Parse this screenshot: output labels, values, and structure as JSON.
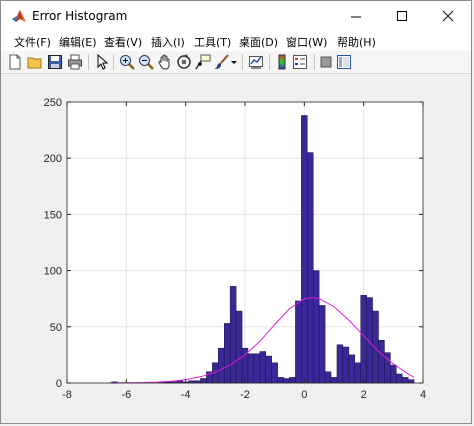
{
  "window": {
    "title": "Error Histogram"
  },
  "menu": [
    {
      "label": "文件(F)"
    },
    {
      "label": "编辑(E)"
    },
    {
      "label": "查看(V)"
    },
    {
      "label": "插入(I)"
    },
    {
      "label": "工具(T)"
    },
    {
      "label": "桌面(D)"
    },
    {
      "label": "窗口(W)"
    },
    {
      "label": "帮助(H)"
    }
  ],
  "toolbar": {
    "icons": [
      "new-figure-icon",
      "open-file-icon",
      "save-icon",
      "print-icon",
      "pointer-icon",
      "zoom-in-icon",
      "zoom-out-icon",
      "pan-hand-icon",
      "rotate-3d-icon",
      "data-cursor-icon",
      "brush-icon",
      "dropdown-arrow-icon",
      "link-plot-icon",
      "colorbar-icon",
      "legend-icon",
      "hide-plot-tools-icon",
      "show-plot-tools-icon"
    ]
  },
  "colors": {
    "bar_fill": "#3a2898",
    "bar_edge": "#1a1240",
    "curve": "#e020e0",
    "grid": "#e6e6e6",
    "axes_bg": "#ffffff"
  },
  "chart_data": {
    "type": "bar",
    "title": "",
    "xlabel": "",
    "ylabel": "",
    "xlim": [
      -8,
      4
    ],
    "ylim": [
      0,
      250
    ],
    "xticks": [
      -8,
      -6,
      -4,
      -2,
      0,
      2,
      4
    ],
    "yticks": [
      0,
      50,
      100,
      150,
      200,
      250
    ],
    "grid": true,
    "bin_width": 0.2,
    "series": [
      {
        "x": [
          -6.4,
          -6.2,
          -6.0,
          -5.8,
          -5.6,
          -5.4,
          -5.2,
          -5.0,
          -4.8,
          -4.6,
          -4.4,
          -4.2,
          -4.0,
          -3.8,
          -3.6,
          -3.4,
          -3.2,
          -3.0,
          -2.8,
          -2.6,
          -2.4,
          -2.2,
          -2.0,
          -1.8,
          -1.6,
          -1.4,
          -1.2,
          -1.0,
          -0.8,
          -0.6,
          -0.4,
          -0.2,
          0.0,
          0.2,
          0.4,
          0.6,
          0.8,
          1.0,
          1.2,
          1.4,
          1.6,
          1.8,
          2.0,
          2.2,
          2.4,
          2.6,
          2.8,
          3.0,
          3.2,
          3.4,
          3.6
        ],
        "values": [
          1,
          0,
          0,
          0,
          0,
          0,
          0,
          0,
          1,
          1,
          1,
          2,
          1,
          2,
          2,
          4,
          10,
          18,
          31,
          53,
          86,
          64,
          31,
          26,
          26,
          28,
          24,
          18,
          5,
          4,
          5,
          73,
          238,
          205,
          100,
          69,
          10,
          5,
          34,
          32,
          25,
          18,
          78,
          76,
          64,
          38,
          27,
          16,
          8,
          5,
          3
        ]
      }
    ],
    "curve": {
      "name": "",
      "x": [
        -6.6,
        -6.0,
        -5.5,
        -5.0,
        -4.5,
        -4.0,
        -3.5,
        -3.0,
        -2.5,
        -2.0,
        -1.5,
        -1.0,
        -0.5,
        0.0,
        0.25,
        0.5,
        1.0,
        1.5,
        2.0,
        2.5,
        3.0,
        3.5,
        3.7
      ],
      "y": [
        0.1,
        0.2,
        0.4,
        0.8,
        1.6,
        3.0,
        5.5,
        9.5,
        16,
        25,
        37,
        52,
        66,
        75,
        76,
        75,
        68,
        56,
        42,
        28,
        17,
        8,
        5
      ]
    }
  }
}
